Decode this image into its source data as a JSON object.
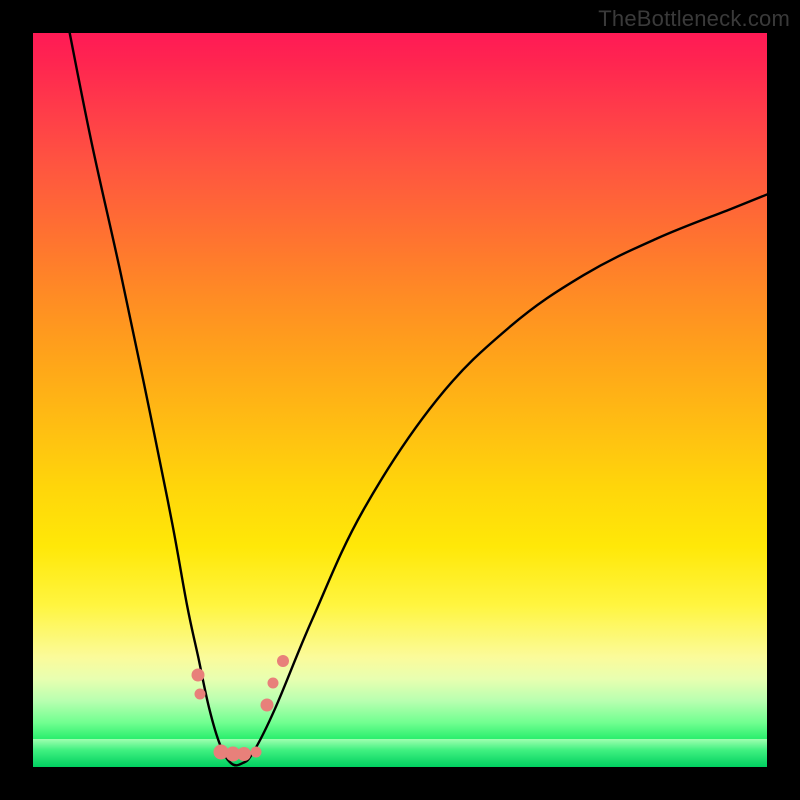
{
  "watermark": "TheBottleneck.com",
  "colors": {
    "frame": "#000000",
    "curve": "#000000",
    "dot": "#e8807a",
    "gradient_top": "#ff1a55",
    "gradient_bottom": "#00c050"
  },
  "chart_data": {
    "type": "line",
    "title": "",
    "xlabel": "",
    "ylabel": "",
    "xlim": [
      0,
      100
    ],
    "ylim": [
      0,
      100
    ],
    "note": "Axes are unlabeled; values below are estimated as percentages of the plotting area (0 = left/bottom, 100 = right/top).",
    "series": [
      {
        "name": "curve",
        "x": [
          5,
          8,
          12,
          16,
          19,
          21,
          22.5,
          24,
          25.5,
          27,
          28.5,
          30,
          33,
          38,
          45,
          55,
          65,
          75,
          85,
          95,
          100
        ],
        "y": [
          100,
          85,
          67,
          48,
          33,
          22,
          15,
          8,
          3,
          0.5,
          0.5,
          2,
          8,
          20,
          35,
          50,
          60,
          67,
          72,
          76,
          78
        ]
      }
    ],
    "annotations": [
      {
        "name": "scatter_dots",
        "note": "Salmon-colored sample markers near the curve trough; sizes in px.",
        "points": [
          {
            "x": 22.5,
            "y": 12.5,
            "size": 13
          },
          {
            "x": 22.8,
            "y": 10.0,
            "size": 11
          },
          {
            "x": 25.6,
            "y": 2.0,
            "size": 15
          },
          {
            "x": 27.3,
            "y": 1.8,
            "size": 15
          },
          {
            "x": 28.8,
            "y": 1.8,
            "size": 14
          },
          {
            "x": 30.4,
            "y": 2.1,
            "size": 11
          },
          {
            "x": 31.9,
            "y": 8.5,
            "size": 13
          },
          {
            "x": 32.7,
            "y": 11.5,
            "size": 11
          },
          {
            "x": 34.1,
            "y": 14.5,
            "size": 12
          }
        ]
      }
    ]
  }
}
